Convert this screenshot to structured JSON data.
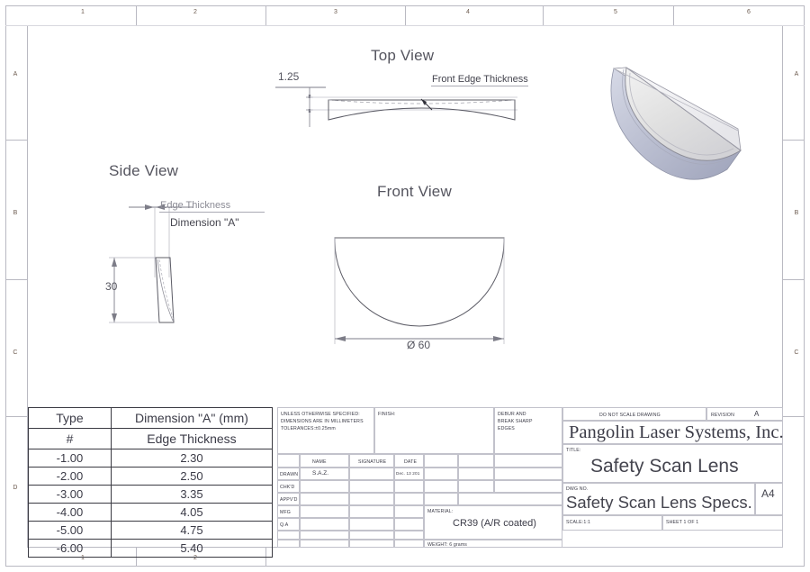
{
  "sheet": {
    "zones_top": [
      "1",
      "2",
      "3",
      "4",
      "5",
      "6"
    ],
    "zones_bottom": [
      "1",
      "2"
    ],
    "zones_left": [
      "A",
      "B",
      "C",
      "D"
    ],
    "zones_right": [
      "A",
      "B",
      "C"
    ]
  },
  "views": {
    "top": {
      "title": "Top View",
      "thickness_dim": "1.25",
      "leader_label": "Front Edge Thickness"
    },
    "side": {
      "title": "Side View",
      "height_dim": "30",
      "edge_thickness_label": "Edge Thickness",
      "dimension_a_label": "Dimension \"A\""
    },
    "front": {
      "title": "Front View",
      "diameter_dim": "Ø 60"
    },
    "iso": {
      "name": "isometric-lens-model"
    }
  },
  "spec_table": {
    "headers": [
      "Type",
      "Dimension \"A\" (mm)"
    ],
    "subheaders": [
      "#",
      "Edge Thickness"
    ],
    "rows": [
      [
        "-1.00",
        "2.30"
      ],
      [
        "-2.00",
        "2.50"
      ],
      [
        "-3.00",
        "3.35"
      ],
      [
        "-4.00",
        "4.05"
      ],
      [
        "-5.00",
        "4.75"
      ],
      [
        "-6.00",
        "5.40"
      ]
    ]
  },
  "title_block": {
    "notes": {
      "line1": "UNLESS OTHERWISE SPECIFIED:",
      "line2": "DIMENSIONS ARE IN MILLIMETERS",
      "line3": "TOLERANCES:±0.25mm"
    },
    "finish_label": "FINISH:",
    "debur": {
      "line1": "DEBUR AND",
      "line2": "BREAK SHARP",
      "line3": "EDGES"
    },
    "grid_headers": [
      "NAME",
      "SIGNATURE",
      "DATE"
    ],
    "grid_rows": [
      "DRAWN",
      "CHK'D",
      "APPV'D",
      "MFG",
      "Q.A"
    ],
    "drawn_name": "S.A.Z.",
    "drawn_date": "Dec. 13 201",
    "material_label": "MATERIAL:",
    "material_value": "CR39 (A/R coated)",
    "weight": "WEIGHT: 6 grams",
    "do_not_scale": "DO NOT SCALE DRAWING",
    "revision_label": "REVISION",
    "revision_value": "A",
    "company": "Pangolin Laser Systems, Inc.",
    "title_label": "TITLE:",
    "title_value": "Safety Scan Lens",
    "dwgno_label": "DWG NO.",
    "dwgno_value": "Safety Scan Lens Specs.",
    "sheet_size": "A4",
    "scale": "SCALE:1:1",
    "sheet_of": "SHEET 1 OF 1"
  }
}
